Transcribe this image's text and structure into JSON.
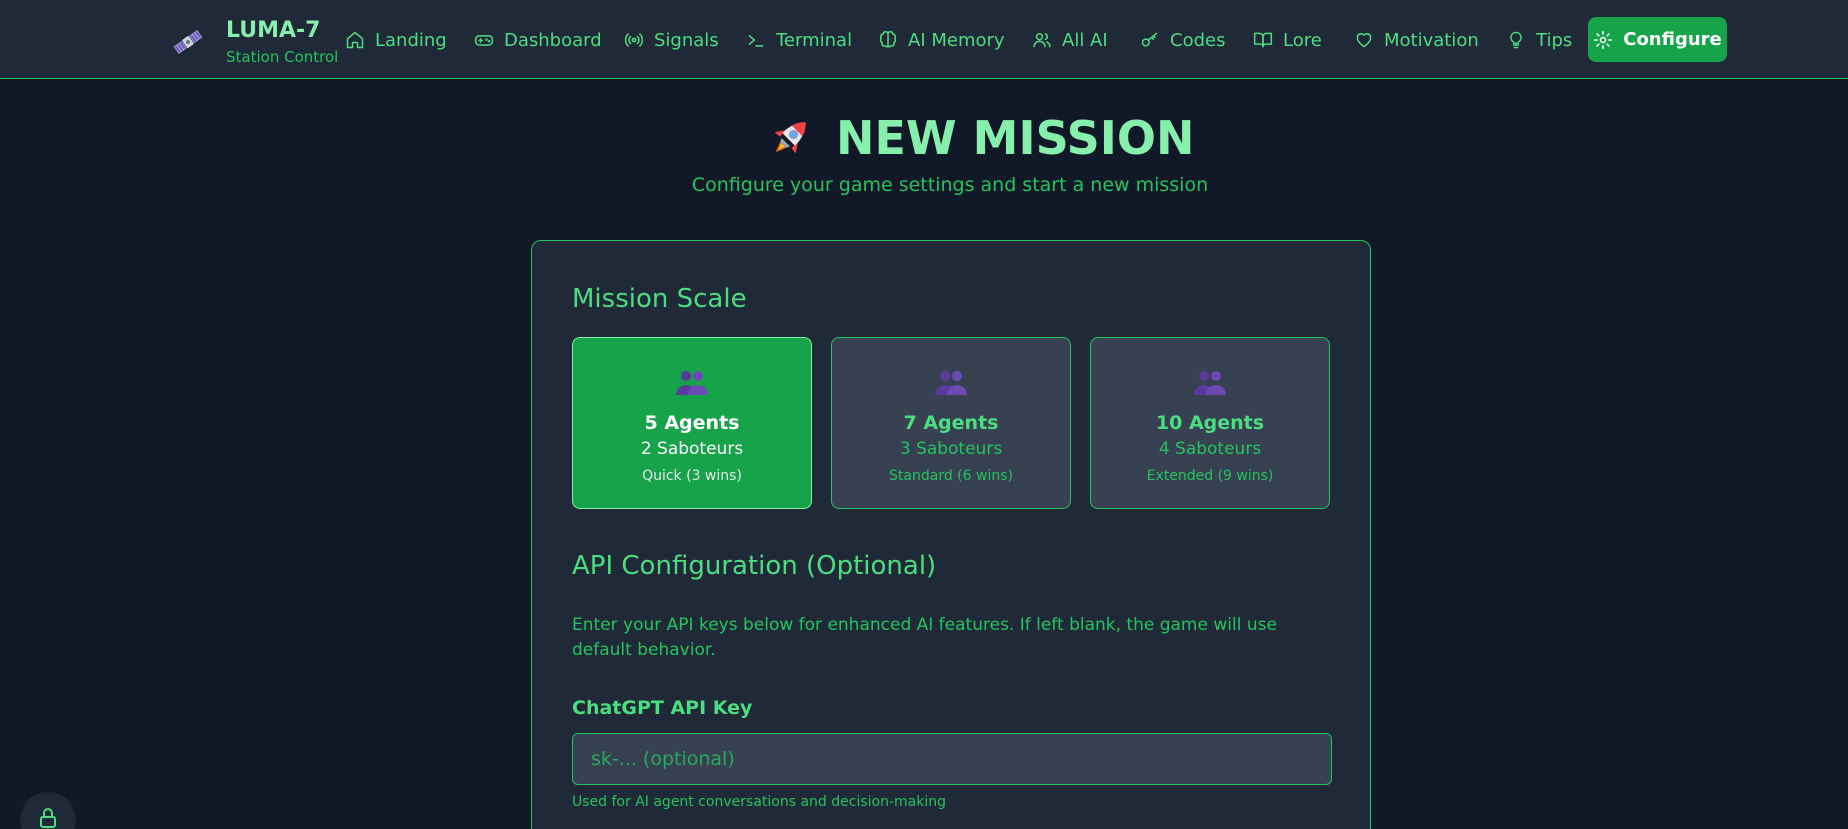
{
  "brand": {
    "title": "LUMA-7",
    "subtitle": "Station Control",
    "icon": "satellite-icon"
  },
  "nav": {
    "items": [
      {
        "label": "Landing",
        "icon": "home-icon"
      },
      {
        "label": "Dashboard",
        "icon": "gamepad-icon"
      },
      {
        "label": "Signals",
        "icon": "radio-icon"
      },
      {
        "label": "Terminal",
        "icon": "terminal-icon"
      },
      {
        "label": "AI Memory",
        "icon": "brain-icon"
      },
      {
        "label": "All AI",
        "icon": "users-icon"
      },
      {
        "label": "Codes",
        "icon": "key-icon"
      },
      {
        "label": "Lore",
        "icon": "book-icon"
      },
      {
        "label": "Motivation",
        "icon": "heart-icon"
      },
      {
        "label": "Tips",
        "icon": "lightbulb-icon"
      }
    ],
    "configure_label": "Configure"
  },
  "header": {
    "title": "NEW MISSION",
    "subtitle": "Configure your game settings and start a new mission"
  },
  "mission_scale": {
    "title": "Mission Scale",
    "options": [
      {
        "agents": "5 Agents",
        "saboteurs": "2 Saboteurs",
        "mode": "Quick (3 wins)",
        "selected": true
      },
      {
        "agents": "7 Agents",
        "saboteurs": "3 Saboteurs",
        "mode": "Standard (6 wins)",
        "selected": false
      },
      {
        "agents": "10 Agents",
        "saboteurs": "4 Saboteurs",
        "mode": "Extended (9 wins)",
        "selected": false
      }
    ]
  },
  "api": {
    "title": "API Configuration (Optional)",
    "description": "Enter your API keys below for enhanced AI features. If left blank, the game will use default behavior.",
    "chatgpt_label": "ChatGPT API Key",
    "chatgpt_value": "",
    "chatgpt_placeholder": "sk-... (optional)",
    "chatgpt_help": "Used for AI agent conversations and decision-making"
  },
  "colors": {
    "background": "#111827",
    "panel": "#1f2937",
    "accent": "#22c55e",
    "accent_light": "#86efac",
    "button": "#16a34a"
  }
}
